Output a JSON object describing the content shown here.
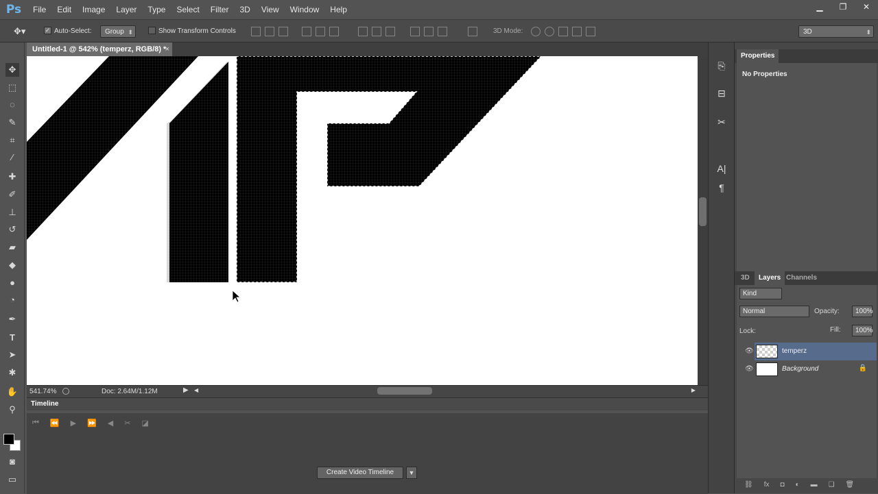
{
  "app": {
    "logo": "Ps"
  },
  "menu": [
    "File",
    "Edit",
    "Image",
    "Layer",
    "Type",
    "Select",
    "Filter",
    "3D",
    "View",
    "Window",
    "Help"
  ],
  "window_controls": [
    "minimize-icon",
    "restore-icon",
    "close-icon"
  ],
  "options": {
    "auto_select_label": "Auto-Select:",
    "auto_select_checked": true,
    "group_value": "Group",
    "show_transform_label": "Show Transform Controls",
    "mode_3d_label": "3D Mode:",
    "workspace_value": "3D"
  },
  "document": {
    "tab_title": "Untitled-1 @ 542% (temperz, RGB/8) *",
    "tab_close": "×"
  },
  "status": {
    "zoom": "541.74%",
    "doc_info": "Doc: 2.64M/1.12M"
  },
  "timeline": {
    "title": "Timeline",
    "create_button": "Create Video Timeline"
  },
  "properties": {
    "tab": "Properties",
    "body": "No Properties"
  },
  "layers_panel": {
    "tabs": [
      "3D",
      "Layers",
      "Channels"
    ],
    "active_tab": "Layers",
    "filter_kind": "Kind",
    "blend_mode": "Normal",
    "opacity_label": "Opacity:",
    "opacity_value": "100%",
    "lock_label": "Lock:",
    "fill_label": "Fill:",
    "fill_value": "100%",
    "layers": [
      {
        "name": "temperz",
        "selected": true,
        "visible": true,
        "locked": false
      },
      {
        "name": "Background",
        "selected": false,
        "visible": true,
        "locked": true
      }
    ]
  },
  "colors": {
    "ui_bg": "#535353",
    "selected_layer": "#576b8d",
    "canvas_black": "#000000",
    "canvas_white": "#ffffff"
  }
}
